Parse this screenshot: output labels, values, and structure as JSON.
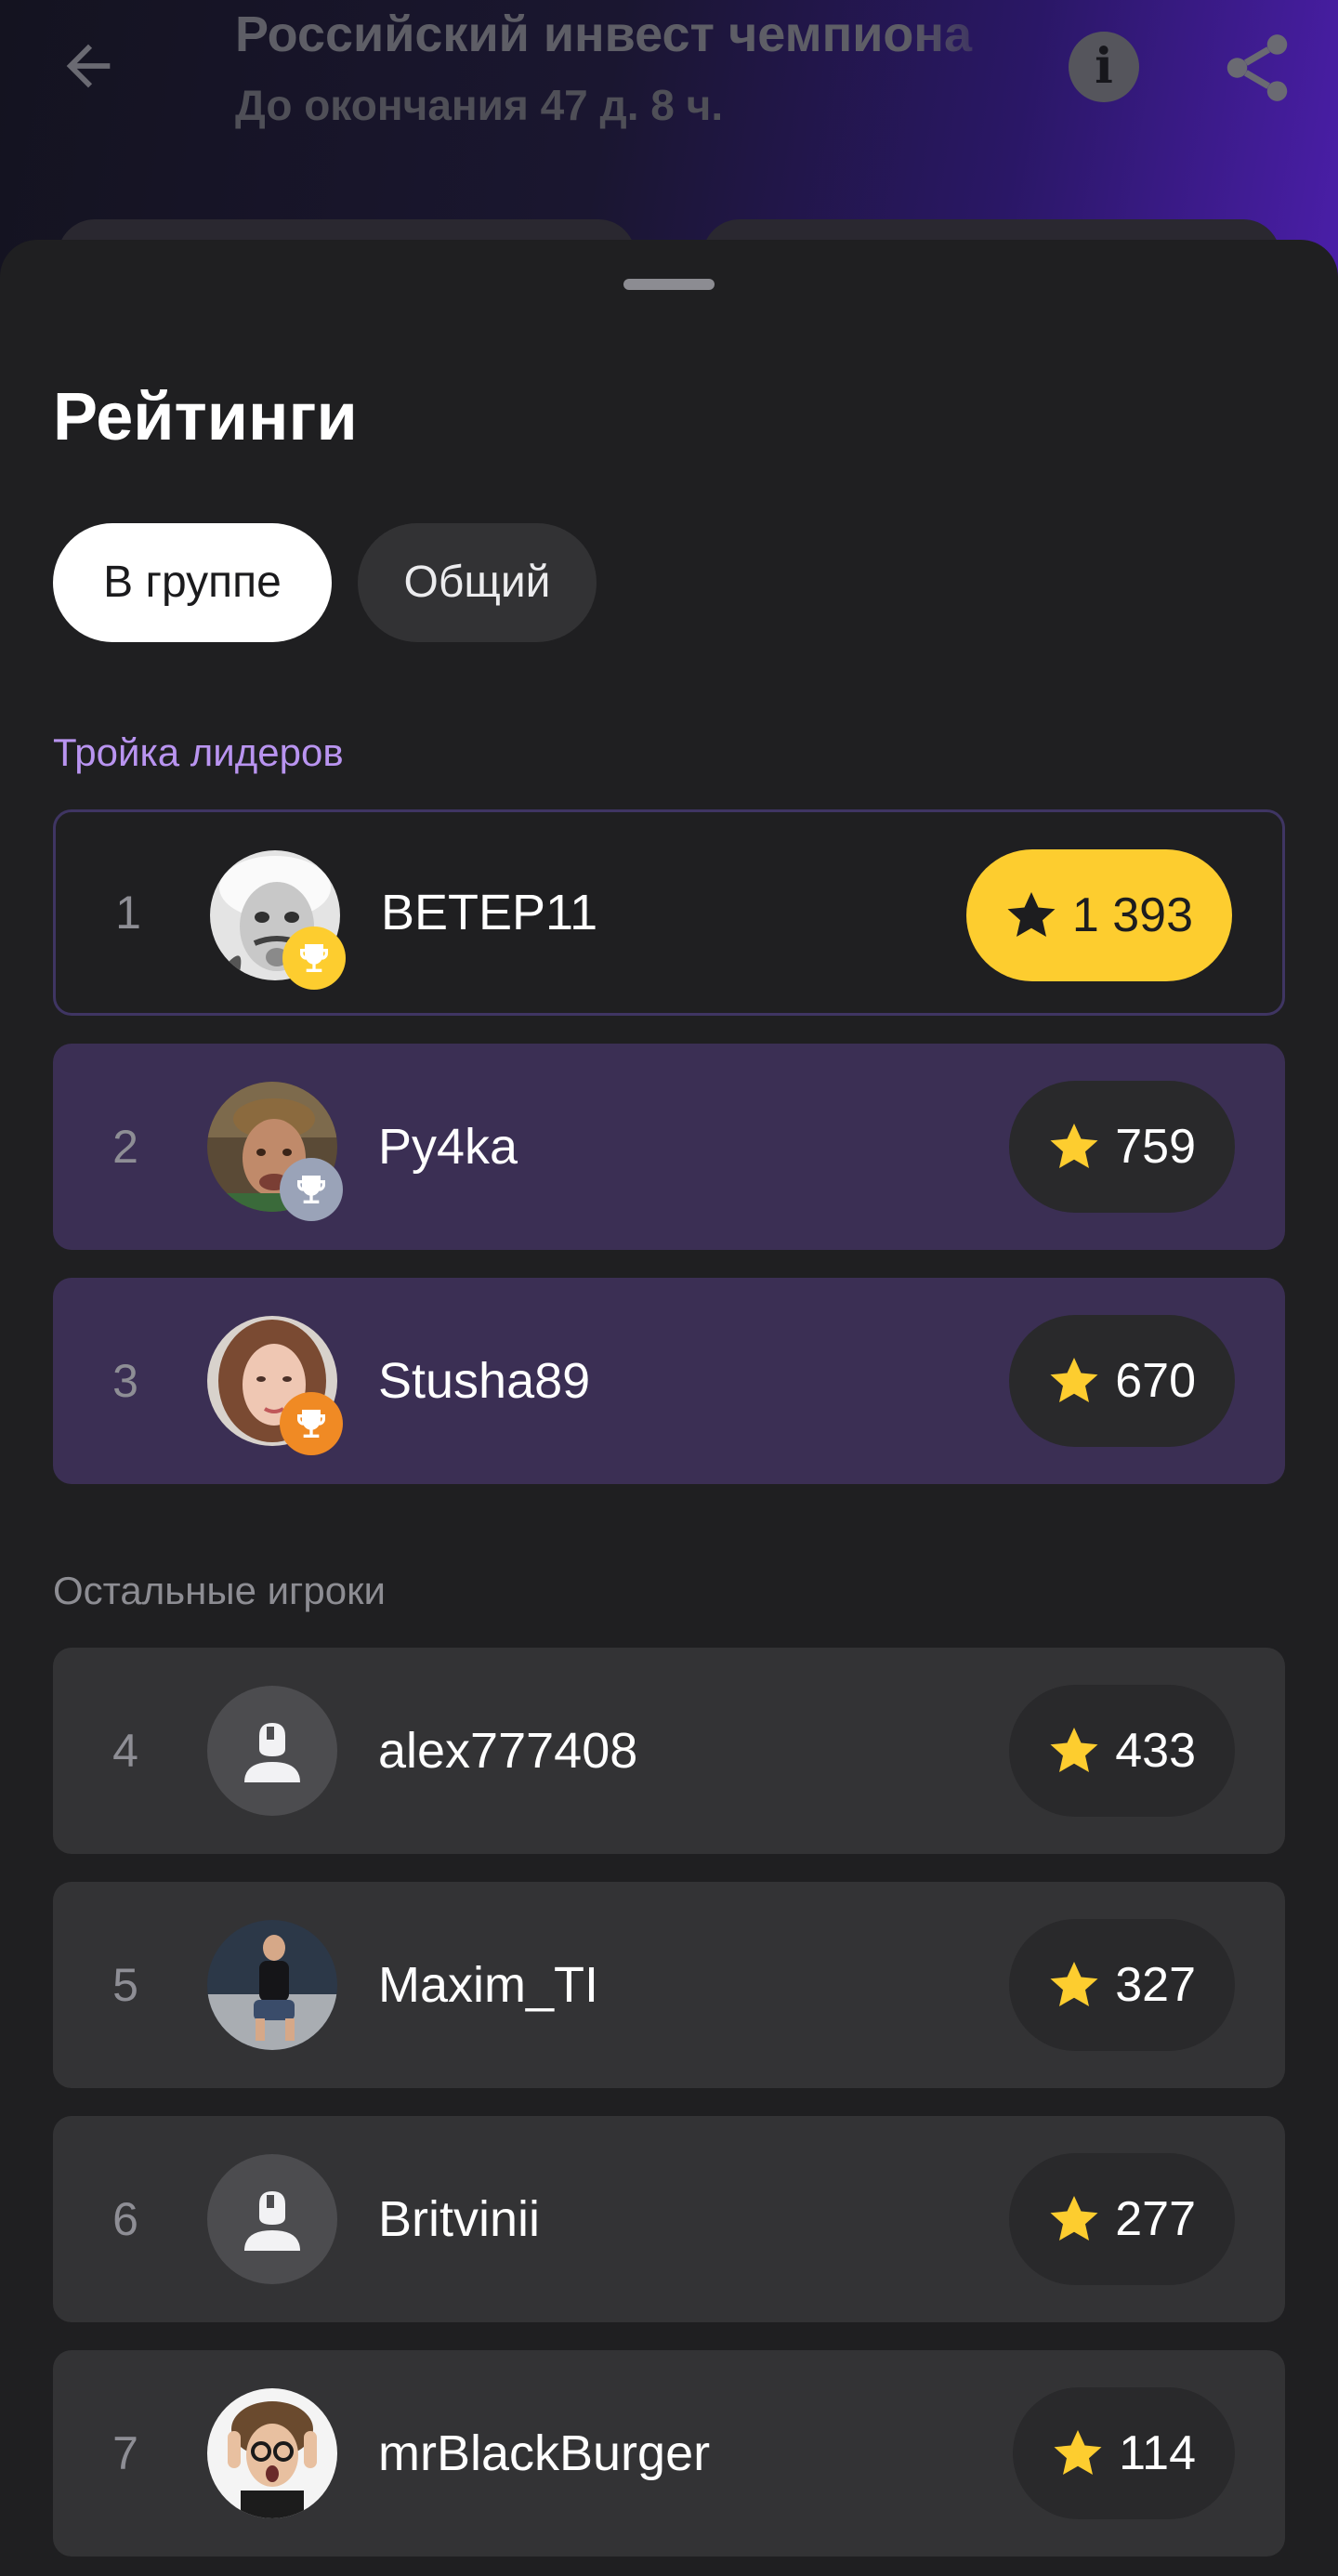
{
  "header": {
    "title": "Российский инвест чемпиона",
    "subtitle": "До окончания 47 д. 8 ч."
  },
  "sheet": {
    "title": "Рейтинги",
    "tabs": [
      {
        "label": "В группе",
        "active": true
      },
      {
        "label": "Общий",
        "active": false
      }
    ]
  },
  "colors": {
    "accent_purple": "#b994f0",
    "gold": "#fdcd2f",
    "silver": "#9aa3b8",
    "bronze": "#f08a24",
    "leader_row": "#3b2f54"
  },
  "leaders": {
    "label": "Тройка лидеров",
    "rows": [
      {
        "rank": "1",
        "name": "ВЕТЕР11",
        "score": "1 393",
        "trophy": "gold-trophy-icon"
      },
      {
        "rank": "2",
        "name": "Ру4ka",
        "score": "759",
        "trophy": "silver-trophy-icon"
      },
      {
        "rank": "3",
        "name": "Stusha89",
        "score": "670",
        "trophy": "bronze-trophy-icon"
      }
    ]
  },
  "others": {
    "label": "Остальные игроки",
    "rows": [
      {
        "rank": "4",
        "name": "alex777408",
        "score": "433",
        "avatar": "default-avatar-icon"
      },
      {
        "rank": "5",
        "name": "Maxim_TI",
        "score": "327",
        "avatar": "photo"
      },
      {
        "rank": "6",
        "name": "Britvinii",
        "score": "277",
        "avatar": "default-avatar-icon"
      },
      {
        "rank": "7",
        "name": "mrBlackBurger",
        "score": "114",
        "avatar": "photo"
      }
    ]
  }
}
